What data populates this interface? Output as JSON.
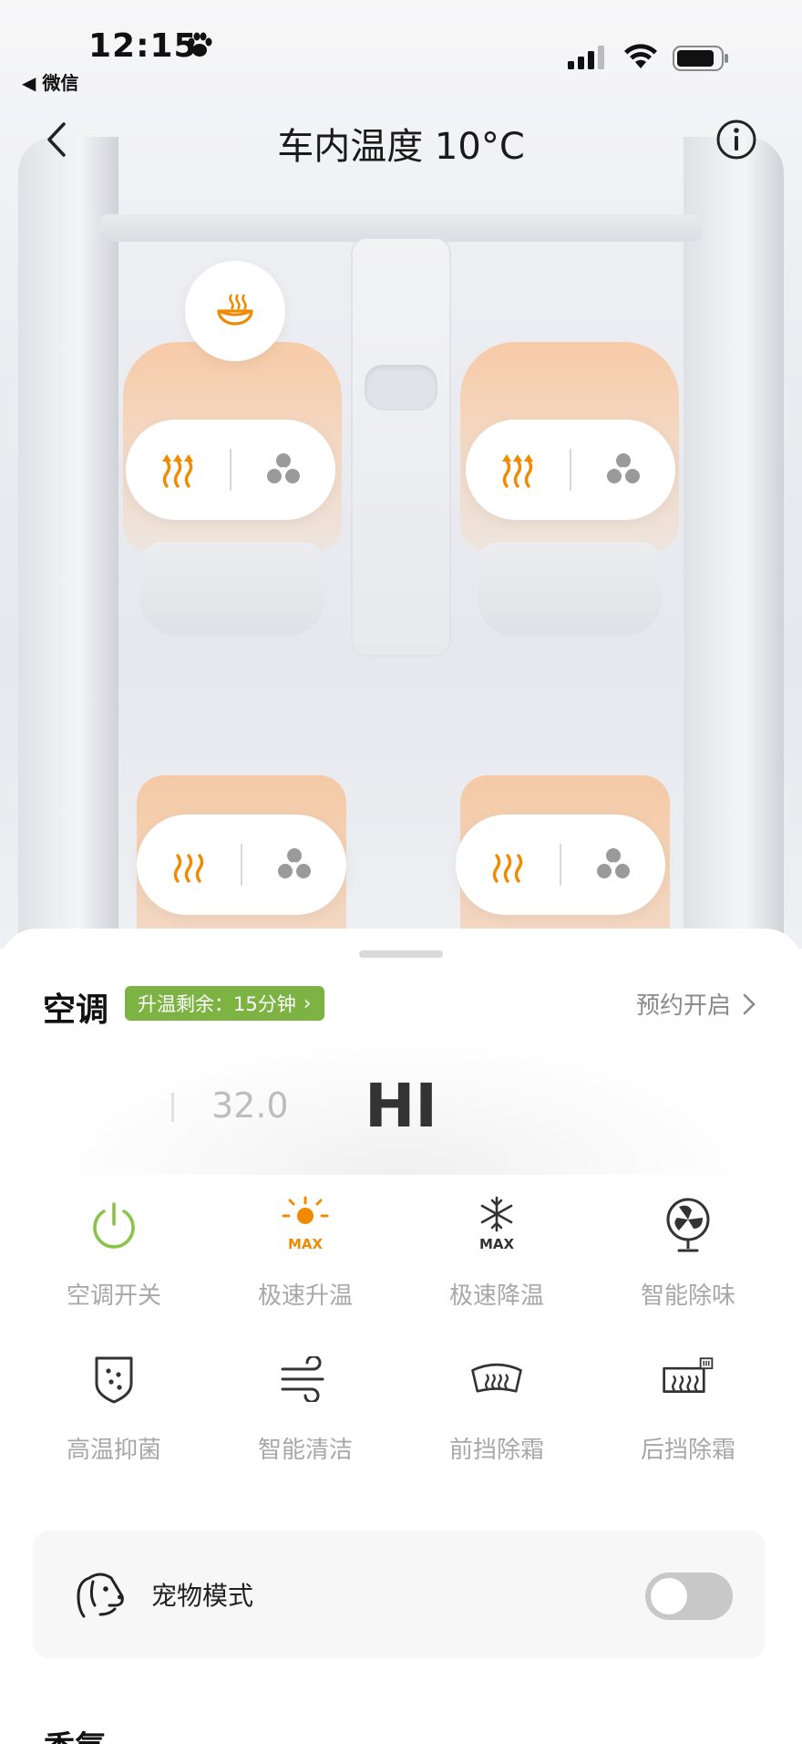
{
  "status_bar": {
    "time": "12:15",
    "back_app": "◀ 微信"
  },
  "header": {
    "title": "车内温度 10°C"
  },
  "colors": {
    "accent_orange": "#F08A00",
    "badge_green": "#7CB342",
    "power_green": "#8BC34A"
  },
  "seats": [
    {
      "position": "front-left",
      "heat": "heat-icon",
      "vent": "fan-icon"
    },
    {
      "position": "front-right",
      "heat": "heat-icon",
      "vent": "fan-icon"
    },
    {
      "position": "rear-left",
      "heat": "heat-icon",
      "vent": "fan-icon"
    },
    {
      "position": "rear-right",
      "heat": "heat-icon",
      "vent": "fan-icon"
    }
  ],
  "ac": {
    "title": "空调",
    "heat_badge": "升温剩余：15分钟",
    "schedule": "预约开启",
    "temp_prev": "32.0",
    "temp_current": "HI"
  },
  "functions": [
    {
      "label": "空调开关",
      "icon": "power-icon"
    },
    {
      "label": "极速升温",
      "icon": "sun-max-icon"
    },
    {
      "label": "极速降温",
      "icon": "snowflake-max-icon"
    },
    {
      "label": "智能除味",
      "icon": "fan-circle-icon"
    },
    {
      "label": "高温抑菌",
      "icon": "shield-dots-icon"
    },
    {
      "label": "智能清洁",
      "icon": "wind-icon"
    },
    {
      "label": "前挡除霜",
      "icon": "front-defrost-icon"
    },
    {
      "label": "后挡除霜",
      "icon": "rear-defrost-icon"
    }
  ],
  "pet_mode": {
    "label": "宠物模式",
    "enabled": false
  },
  "next_section": {
    "title": "香氛"
  }
}
